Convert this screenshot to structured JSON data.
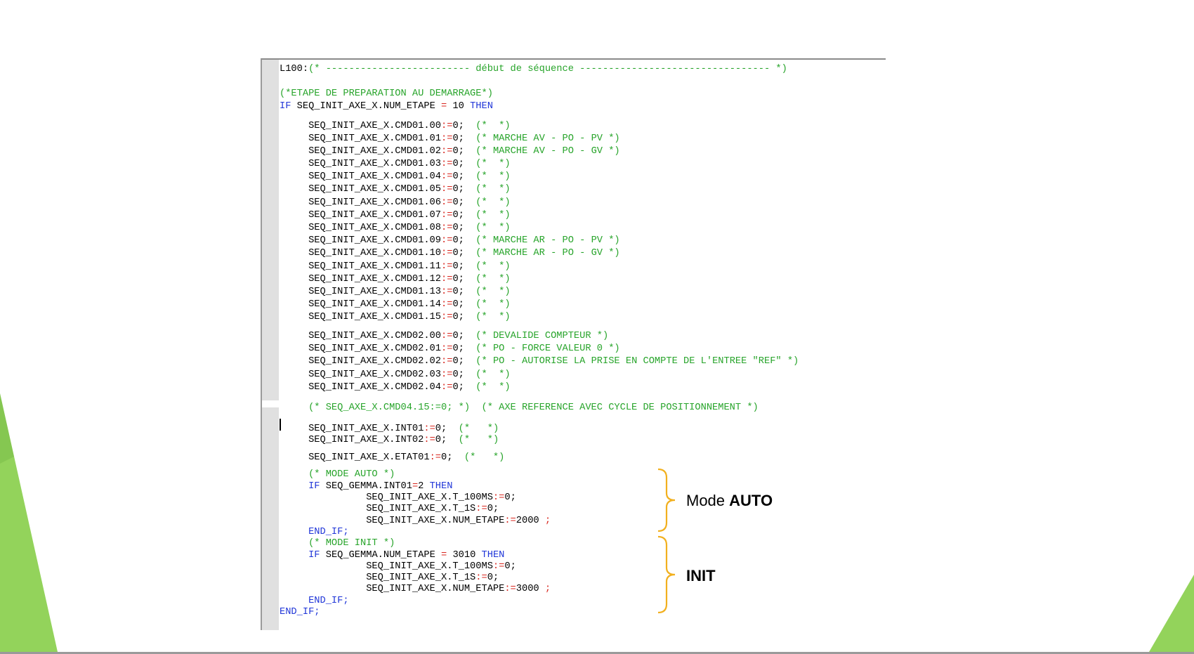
{
  "code": {
    "lines": [
      {
        "t": [
          [
            "L100:",
            ""
          ],
          [
            "(* ------------------------- début de séquence --------------------------------- *)",
            "cm"
          ]
        ]
      },
      {
        "t": [
          [
            "(*ETAPE DE PREPARATION AU DEMARRAGE*)",
            "cm"
          ]
        ]
      },
      {
        "t": [
          [
            "IF",
            "kw"
          ],
          [
            " SEQ_INIT_AXE_X.NUM_ETAPE ",
            ""
          ],
          [
            "=",
            "op"
          ],
          [
            " 10 ",
            ""
          ],
          [
            "THEN",
            "kw"
          ]
        ]
      },
      {
        "t": [
          [
            "     SEQ_INIT_AXE_X.CMD01.00",
            ""
          ],
          [
            ":=",
            "op"
          ],
          [
            "0;  ",
            ""
          ],
          [
            "(*  *)",
            "cm"
          ]
        ]
      },
      {
        "t": [
          [
            "     SEQ_INIT_AXE_X.CMD01.01",
            ""
          ],
          [
            ":=",
            "op"
          ],
          [
            "0;  ",
            ""
          ],
          [
            "(* MARCHE AV - PO - PV *)",
            "cm"
          ]
        ]
      },
      {
        "t": [
          [
            "     SEQ_INIT_AXE_X.CMD01.02",
            ""
          ],
          [
            ":=",
            "op"
          ],
          [
            "0;  ",
            ""
          ],
          [
            "(* MARCHE AV - PO - GV *)",
            "cm"
          ]
        ]
      },
      {
        "t": [
          [
            "     SEQ_INIT_AXE_X.CMD01.03",
            ""
          ],
          [
            ":=",
            "op"
          ],
          [
            "0;  ",
            ""
          ],
          [
            "(*  *)",
            "cm"
          ]
        ]
      },
      {
        "t": [
          [
            "     SEQ_INIT_AXE_X.CMD01.04",
            ""
          ],
          [
            ":=",
            "op"
          ],
          [
            "0;  ",
            ""
          ],
          [
            "(*  *)",
            "cm"
          ]
        ]
      },
      {
        "t": [
          [
            "     SEQ_INIT_AXE_X.CMD01.05",
            ""
          ],
          [
            ":=",
            "op"
          ],
          [
            "0;  ",
            ""
          ],
          [
            "(*  *)",
            "cm"
          ]
        ]
      },
      {
        "t": [
          [
            "     SEQ_INIT_AXE_X.CMD01.06",
            ""
          ],
          [
            ":=",
            "op"
          ],
          [
            "0;  ",
            ""
          ],
          [
            "(*  *)",
            "cm"
          ]
        ]
      },
      {
        "t": [
          [
            "     SEQ_INIT_AXE_X.CMD01.07",
            ""
          ],
          [
            ":=",
            "op"
          ],
          [
            "0;  ",
            ""
          ],
          [
            "(*  *)",
            "cm"
          ]
        ]
      },
      {
        "t": [
          [
            "     SEQ_INIT_AXE_X.CMD01.08",
            ""
          ],
          [
            ":=",
            "op"
          ],
          [
            "0;  ",
            ""
          ],
          [
            "(*  *)",
            "cm"
          ]
        ]
      },
      {
        "t": [
          [
            "     SEQ_INIT_AXE_X.CMD01.09",
            ""
          ],
          [
            ":=",
            "op"
          ],
          [
            "0;  ",
            ""
          ],
          [
            "(* MARCHE AR - PO - PV *)",
            "cm"
          ]
        ]
      },
      {
        "t": [
          [
            "     SEQ_INIT_AXE_X.CMD01.10",
            ""
          ],
          [
            ":=",
            "op"
          ],
          [
            "0;  ",
            ""
          ],
          [
            "(* MARCHE AR - PO - GV *)",
            "cm"
          ]
        ]
      },
      {
        "t": [
          [
            "     SEQ_INIT_AXE_X.CMD01.11",
            ""
          ],
          [
            ":=",
            "op"
          ],
          [
            "0;  ",
            ""
          ],
          [
            "(*  *)",
            "cm"
          ]
        ]
      },
      {
        "t": [
          [
            "     SEQ_INIT_AXE_X.CMD01.12",
            ""
          ],
          [
            ":=",
            "op"
          ],
          [
            "0;  ",
            ""
          ],
          [
            "(*  *)",
            "cm"
          ]
        ]
      },
      {
        "t": [
          [
            "     SEQ_INIT_AXE_X.CMD01.13",
            ""
          ],
          [
            ":=",
            "op"
          ],
          [
            "0;  ",
            ""
          ],
          [
            "(*  *)",
            "cm"
          ]
        ]
      },
      {
        "t": [
          [
            "     SEQ_INIT_AXE_X.CMD01.14",
            ""
          ],
          [
            ":=",
            "op"
          ],
          [
            "0;  ",
            ""
          ],
          [
            "(*  *)",
            "cm"
          ]
        ]
      },
      {
        "t": [
          [
            "     SEQ_INIT_AXE_X.CMD01.15",
            ""
          ],
          [
            ":=",
            "op"
          ],
          [
            "0;  ",
            ""
          ],
          [
            "(*  *)",
            "cm"
          ]
        ]
      },
      {
        "t": [
          [
            "     SEQ_INIT_AXE_X.CMD02.00",
            ""
          ],
          [
            ":=",
            "op"
          ],
          [
            "0;  ",
            ""
          ],
          [
            "(* DEVALIDE COMPTEUR *)",
            "cm"
          ]
        ]
      },
      {
        "t": [
          [
            "     SEQ_INIT_AXE_X.CMD02.01",
            ""
          ],
          [
            ":=",
            "op"
          ],
          [
            "0;  ",
            ""
          ],
          [
            "(* PO - FORCE VALEUR 0 *)",
            "cm"
          ]
        ]
      },
      {
        "t": [
          [
            "     SEQ_INIT_AXE_X.CMD02.02",
            ""
          ],
          [
            ":=",
            "op"
          ],
          [
            "0;  ",
            ""
          ],
          [
            "(* PO - AUTORISE LA PRISE EN COMPTE DE L'ENTREE \"REF\" *)",
            "cm"
          ]
        ]
      },
      {
        "t": [
          [
            "     SEQ_INIT_AXE_X.CMD02.03",
            ""
          ],
          [
            ":=",
            "op"
          ],
          [
            "0;  ",
            ""
          ],
          [
            "(*  *)",
            "cm"
          ]
        ]
      },
      {
        "t": [
          [
            "     SEQ_INIT_AXE_X.CMD02.04",
            ""
          ],
          [
            ":=",
            "op"
          ],
          [
            "0;  ",
            ""
          ],
          [
            "(*  *)",
            "cm"
          ]
        ]
      },
      {
        "t": [
          [
            "     (* SEQ_AXE_X.CMD04.15:=0; *)  (* AXE REFERENCE AVEC CYCLE DE POSITIONNEMENT *)",
            "cm"
          ]
        ]
      },
      {
        "t": [
          [
            "     SEQ_INIT_AXE_X.INT01",
            ""
          ],
          [
            ":=",
            "op"
          ],
          [
            "0;  ",
            ""
          ],
          [
            "(*   *)",
            "cm"
          ]
        ]
      },
      {
        "t": [
          [
            "     SEQ_INIT_AXE_X.INT02",
            ""
          ],
          [
            ":=",
            "op"
          ],
          [
            "0;  ",
            ""
          ],
          [
            "(*   *)",
            "cm"
          ]
        ]
      },
      {
        "t": [
          [
            "     SEQ_INIT_AXE_X.ETAT01",
            ""
          ],
          [
            ":=",
            "op"
          ],
          [
            "0;  ",
            ""
          ],
          [
            "(*   *)",
            "cm"
          ]
        ]
      },
      {
        "t": [
          [
            "     (* MODE AUTO *)",
            "cm"
          ]
        ]
      },
      {
        "t": [
          [
            "     ",
            ""
          ],
          [
            "IF",
            "kw"
          ],
          [
            " SEQ_GEMMA.INT01",
            ""
          ],
          [
            "=",
            "op"
          ],
          [
            "2 ",
            ""
          ],
          [
            "THEN",
            "kw"
          ]
        ]
      },
      {
        "t": [
          [
            "               SEQ_INIT_AXE_X.T_100MS",
            ""
          ],
          [
            ":=",
            "op"
          ],
          [
            "0;",
            ""
          ]
        ]
      },
      {
        "t": [
          [
            "               SEQ_INIT_AXE_X.T_1S",
            ""
          ],
          [
            ":=",
            "op"
          ],
          [
            "0;",
            ""
          ]
        ]
      },
      {
        "t": [
          [
            "               SEQ_INIT_AXE_X.NUM_ETAPE",
            ""
          ],
          [
            ":=",
            "op"
          ],
          [
            "2000 ",
            ""
          ],
          [
            ";",
            "op"
          ]
        ]
      },
      {
        "t": [
          [
            "     ",
            ""
          ],
          [
            "END_IF;",
            "kw"
          ]
        ]
      },
      {
        "t": [
          [
            "     (* MODE INIT *)",
            "cm"
          ]
        ]
      },
      {
        "t": [
          [
            "     ",
            ""
          ],
          [
            "IF",
            "kw"
          ],
          [
            " SEQ_GEMMA.NUM_ETAPE ",
            ""
          ],
          [
            "=",
            "op"
          ],
          [
            " 3010 ",
            ""
          ],
          [
            "THEN",
            "kw"
          ]
        ]
      },
      {
        "t": [
          [
            "               SEQ_INIT_AXE_X.T_100MS",
            ""
          ],
          [
            ":=",
            "op"
          ],
          [
            "0;",
            ""
          ]
        ]
      },
      {
        "t": [
          [
            "               SEQ_INIT_AXE_X.T_1S",
            ""
          ],
          [
            ":=",
            "op"
          ],
          [
            "0;",
            ""
          ]
        ]
      },
      {
        "t": [
          [
            "               SEQ_INIT_AXE_X.NUM_ETAPE",
            ""
          ],
          [
            ":=",
            "op"
          ],
          [
            "3000 ",
            ""
          ],
          [
            ";",
            "op"
          ]
        ]
      },
      {
        "t": [
          [
            "     ",
            ""
          ],
          [
            "END_IF;",
            "kw"
          ]
        ]
      },
      {
        "t": [
          [
            "END_IF;",
            "kw"
          ]
        ]
      }
    ]
  },
  "annotations": {
    "auto": {
      "prefix": "Mode ",
      "bold": "AUTO"
    },
    "init": {
      "bold": "INIT"
    }
  },
  "colors": {
    "keyword": "#1f35d8",
    "operator": "#d8261e",
    "comment": "#27a42a",
    "accent_green": "#93d35b",
    "brace": "#f2b01e"
  }
}
